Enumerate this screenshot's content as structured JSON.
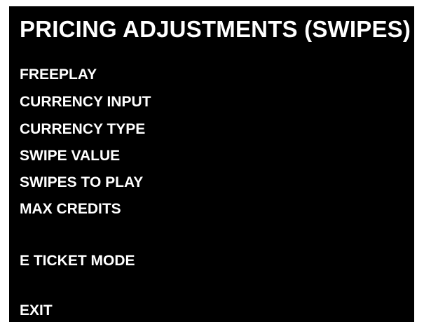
{
  "screen": {
    "title": "PRICING ADJUSTMENTS (SWIPES)",
    "menu_items": [
      {
        "label": "FREEPLAY"
      },
      {
        "label": "CURRENCY INPUT"
      },
      {
        "label": "CURRENCY TYPE"
      },
      {
        "label": "SWIPE VALUE"
      },
      {
        "label": "SWIPES TO PLAY"
      },
      {
        "label": "MAX CREDITS"
      },
      {
        "label": "E TICKET MODE"
      },
      {
        "label": "EXIT"
      }
    ],
    "colors": {
      "background": "#000000",
      "text": "#ffffff"
    }
  }
}
